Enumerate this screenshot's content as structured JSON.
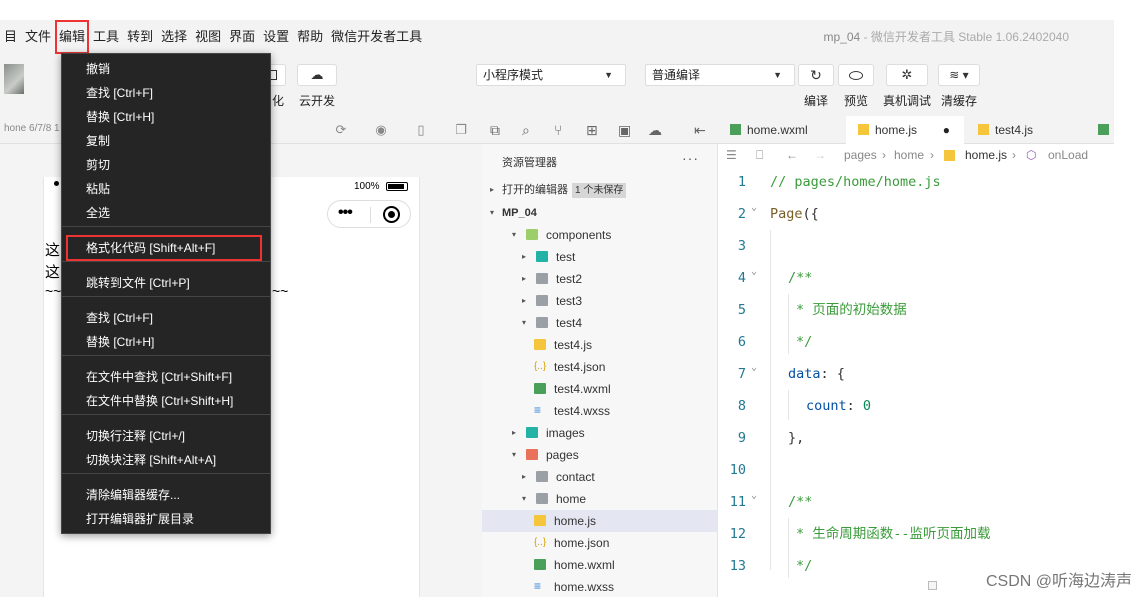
{
  "menubar": {
    "items": [
      "目",
      "文件",
      "编辑",
      "工具",
      "转到",
      "选择",
      "视图",
      "界面",
      "设置",
      "帮助",
      "微信开发者工具"
    ],
    "window_title": "mp_04",
    "app_name": "- 微信开发者工具 Stable 1.06.2402040"
  },
  "toolbar": {
    "partial_label": "化",
    "cloud_label": "云开发",
    "mode_select": "小程序模式",
    "compile_select": "普通编译",
    "compile_label": "编译",
    "preview_label": "预览",
    "debug_label": "真机调试",
    "clear_cache_label": "清缓存"
  },
  "simulator": {
    "device_label": "hone 6/7/8 1",
    "battery_pct": "100%",
    "text_line1": "这",
    "text_line2": "这",
    "tilde_left": "~~",
    "tilde_right": "~~"
  },
  "explorer": {
    "title": "资源管理器",
    "more": "···",
    "open_editors": "打开的编辑器",
    "unsaved_badge": "1 个未保存",
    "tree": [
      {
        "label": "MP_04",
        "depth": 0,
        "arrow": "▾",
        "type": "root"
      },
      {
        "label": "components",
        "depth": 1,
        "arrow": "▾",
        "type": "folder-green"
      },
      {
        "label": "test",
        "depth": 2,
        "arrow": "▸",
        "type": "folder-teal"
      },
      {
        "label": "test2",
        "depth": 2,
        "arrow": "▸",
        "type": "folder"
      },
      {
        "label": "test3",
        "depth": 2,
        "arrow": "▸",
        "type": "folder"
      },
      {
        "label": "test4",
        "depth": 2,
        "arrow": "▾",
        "type": "folder"
      },
      {
        "label": "test4.js",
        "depth": 3,
        "arrow": "",
        "type": "js"
      },
      {
        "label": "test4.json",
        "depth": 3,
        "arrow": "",
        "type": "json"
      },
      {
        "label": "test4.wxml",
        "depth": 3,
        "arrow": "",
        "type": "wxml"
      },
      {
        "label": "test4.wxss",
        "depth": 3,
        "arrow": "",
        "type": "wxss"
      },
      {
        "label": "images",
        "depth": 1,
        "arrow": "▸",
        "type": "folder-teal"
      },
      {
        "label": "pages",
        "depth": 1,
        "arrow": "▾",
        "type": "folder-orange"
      },
      {
        "label": "contact",
        "depth": 2,
        "arrow": "▸",
        "type": "folder"
      },
      {
        "label": "home",
        "depth": 2,
        "arrow": "▾",
        "type": "folder"
      },
      {
        "label": "home.js",
        "depth": 3,
        "arrow": "",
        "type": "js",
        "selected": true
      },
      {
        "label": "home.json",
        "depth": 3,
        "arrow": "",
        "type": "json"
      },
      {
        "label": "home.wxml",
        "depth": 3,
        "arrow": "",
        "type": "wxml"
      },
      {
        "label": "home.wxss",
        "depth": 3,
        "arrow": "",
        "type": "wxss"
      }
    ]
  },
  "editor": {
    "tabs": [
      {
        "label": "home.wxml",
        "type": "wxml"
      },
      {
        "label": "home.js",
        "type": "js",
        "active": true,
        "dirty": "●"
      },
      {
        "label": "test4.js",
        "type": "js"
      }
    ],
    "breadcrumb": {
      "seg1": "pages",
      "seg2": "home",
      "seg3": "home.js",
      "seg4": "onLoad"
    },
    "lines": [
      {
        "n": "1",
        "text": "// pages/home/home.js"
      },
      {
        "n": "2",
        "text": "Page({"
      },
      {
        "n": "3",
        "text": ""
      },
      {
        "n": "4",
        "text": "/**"
      },
      {
        "n": "5",
        "text": "* 页面的初始数据"
      },
      {
        "n": "6",
        "text": "*/"
      },
      {
        "n": "7",
        "text": "data: {"
      },
      {
        "n": "8",
        "text": "count: 0"
      },
      {
        "n": "9",
        "text": "},"
      },
      {
        "n": "10",
        "text": ""
      },
      {
        "n": "11",
        "text": "/**"
      },
      {
        "n": "12",
        "text": "* 生命周期函数--监听页面加载"
      },
      {
        "n": "13",
        "text": "*/"
      }
    ]
  },
  "dropdown": {
    "items": [
      {
        "label": "撤销"
      },
      {
        "label": "查找 [Ctrl+F]"
      },
      {
        "label": "替换 [Ctrl+H]"
      },
      {
        "label": "复制"
      },
      {
        "label": "剪切"
      },
      {
        "label": "粘贴"
      },
      {
        "label": "全选"
      },
      {
        "label": "格式化代码 [Shift+Alt+F]",
        "highlight": true
      },
      {
        "label": "跳转到文件 [Ctrl+P]"
      },
      {
        "label": "查找 [Ctrl+F]"
      },
      {
        "label": "替换 [Ctrl+H]"
      },
      {
        "label": "在文件中查找 [Ctrl+Shift+F]"
      },
      {
        "label": "在文件中替换 [Ctrl+Shift+H]"
      },
      {
        "label": "切换行注释 [Ctrl+/]"
      },
      {
        "label": "切换块注释 [Shift+Alt+A]"
      },
      {
        "label": "清除编辑器缓存..."
      },
      {
        "label": "打开编辑器扩展目录"
      }
    ]
  },
  "watermark": "CSDN @听海边涛声",
  "colors": {
    "menu_bg": "#252526",
    "highlight_border": "#e33333",
    "comment": "#3a9b3a",
    "selected_row": "#e4e6f1"
  }
}
